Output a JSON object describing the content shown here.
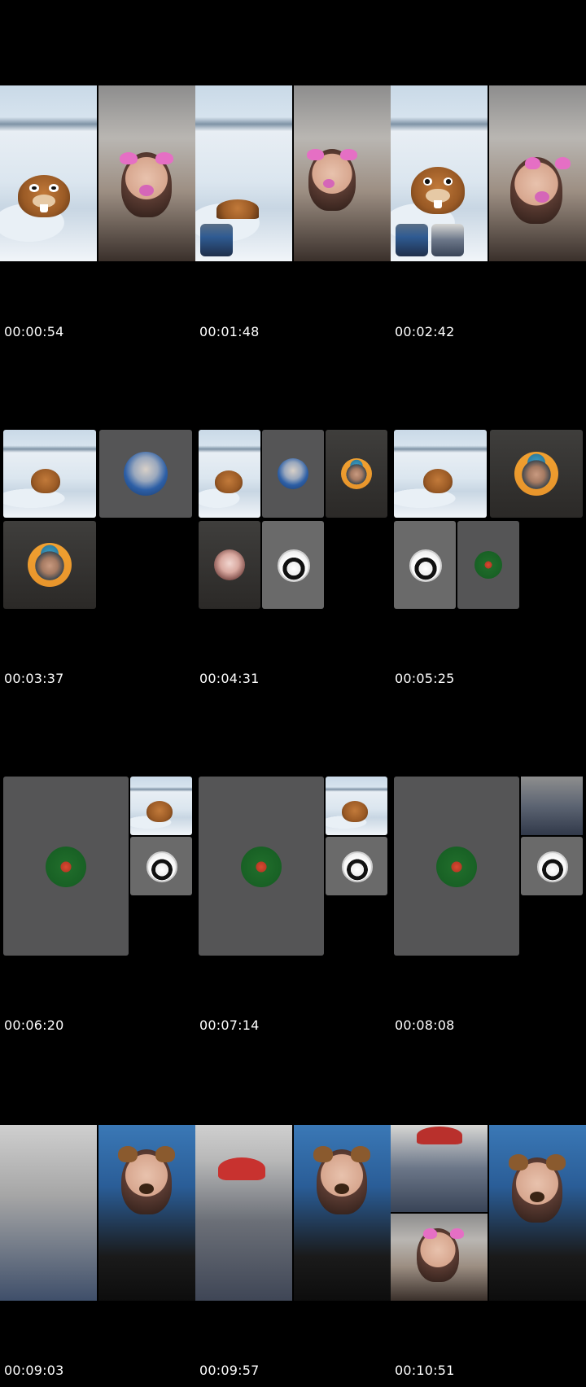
{
  "timestamps": [
    "00:00:54",
    "00:01:48",
    "00:02:42",
    "00:03:37",
    "00:04:31",
    "00:05:25",
    "00:06:20",
    "00:07:14",
    "00:08:08",
    "00:09:03",
    "00:09:57",
    "00:10:51"
  ],
  "colors": {
    "background": "#000000",
    "tile_gray": "#555556",
    "timestamp_text": "#ffffff"
  }
}
